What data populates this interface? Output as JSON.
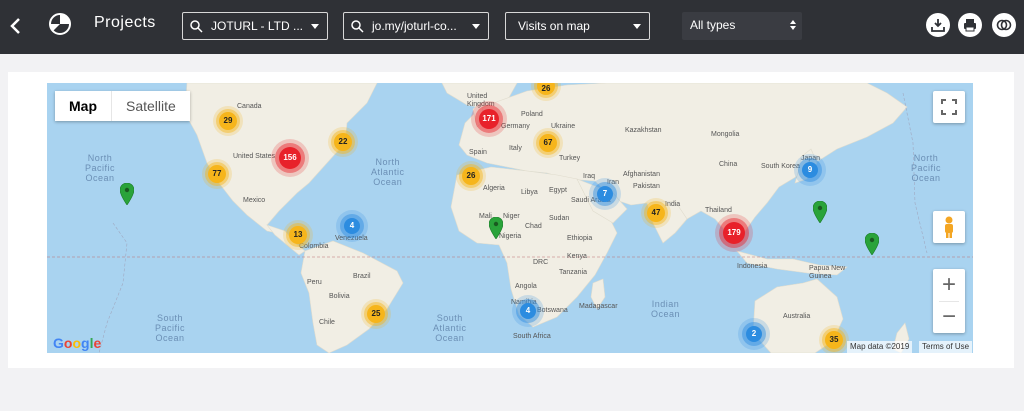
{
  "header": {
    "title": "Projects",
    "dropdowns": {
      "project": "JOTURL - LTD ...",
      "link": "jo.my/joturl-co...",
      "view": "Visits on map",
      "type": "All types"
    }
  },
  "map": {
    "type_buttons": {
      "map": "Map",
      "satellite": "Satellite"
    },
    "zoom": {
      "in": "+",
      "out": "−"
    },
    "attribution": {
      "data": "Map data ©2019",
      "terms": "Terms of Use"
    },
    "google": "Google",
    "oceans": {
      "np_left": "North\nPacific\nOcean",
      "na": "North\nAtlantic\nOcean",
      "np_right": "North\nPacific\nOcean",
      "sp": "South\nPacific\nOcean",
      "sa": "South\nAtlantic\nOcean",
      "io": "Indian\nOcean"
    },
    "labels": {
      "canada": "Canada",
      "us": "United States",
      "mexico": "Mexico",
      "colombia": "Colombia",
      "venezuela": "Venezuela",
      "peru": "Peru",
      "brazil": "Brazil",
      "bolivia": "Bolivia",
      "chile": "Chile",
      "uk": "United\nKingdom",
      "germany": "Germany",
      "poland": "Poland",
      "ukraine": "Ukraine",
      "spain": "Spain",
      "italy": "Italy",
      "turkey": "Turkey",
      "kazakhstan": "Kazakhstan",
      "mongolia": "Mongolia",
      "china": "China",
      "japan": "Japan",
      "south_korea": "South Korea",
      "afghanistan": "Afghanistan",
      "pakistan": "Pakistan",
      "iraq": "Iraq",
      "iran": "Iran",
      "saudi": "Saudi Arabia",
      "india": "India",
      "thailand": "Thailand",
      "indonesia": "Indonesia",
      "algeria": "Algeria",
      "libya": "Libya",
      "egypt": "Egypt",
      "mali": "Mali",
      "niger": "Niger",
      "chad": "Chad",
      "sudan": "Sudan",
      "nigeria": "Nigeria",
      "ethiopia": "Ethiopia",
      "drc": "DRC",
      "kenya": "Kenya",
      "tanzania": "Tanzania",
      "angola": "Angola",
      "namibia": "Namibia",
      "botswana": "Botswana",
      "south_africa": "South Africa",
      "madagascar": "Madagascar",
      "png": "Papua New\nGuinea",
      "australia": "Australia"
    },
    "clusters": {
      "c29": "29",
      "c22": "22",
      "c156": "156",
      "c77": "77",
      "c13": "13",
      "c4a": "4",
      "c26a": "26",
      "c171": "171",
      "c67": "67",
      "c26b": "26",
      "c7": "7",
      "c47": "47",
      "c9": "9",
      "c179": "179",
      "c25": "25",
      "c4b": "4",
      "c2": "2",
      "c35": "35"
    }
  },
  "colors": {
    "topbar": "#2f3136",
    "water": "#a9d3f0",
    "land": "#f1eee4",
    "cluster_yellow": "#f6b51b",
    "cluster_red": "#e8212a",
    "cluster_blue": "#2c8ce0",
    "pin_green": "#2aa33a"
  }
}
